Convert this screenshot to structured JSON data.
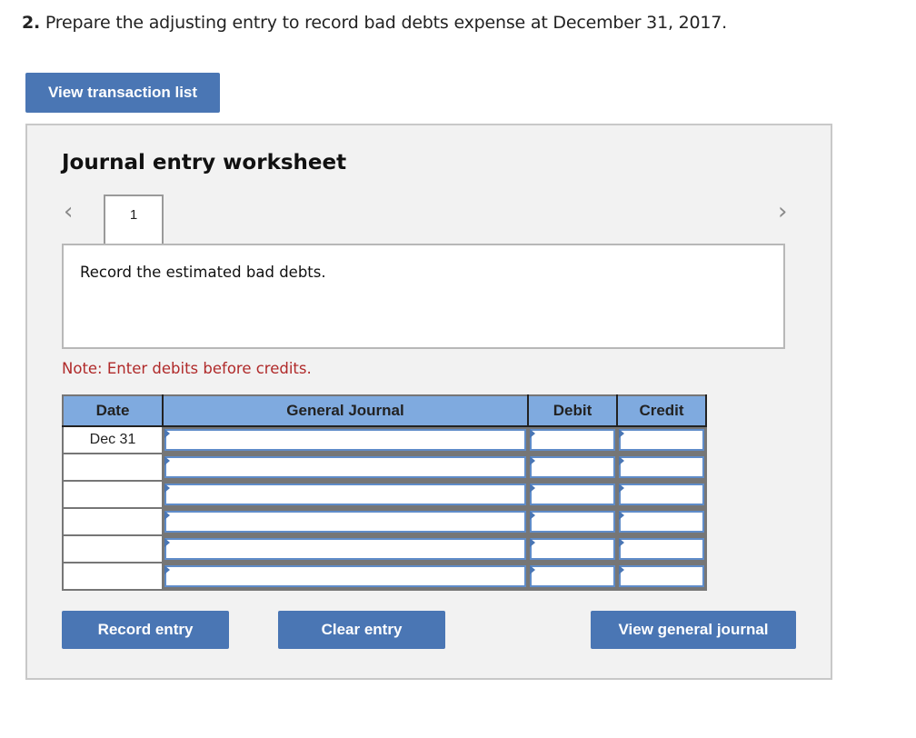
{
  "question": {
    "number": "2.",
    "text": " Prepare the adjusting entry to record bad debts expense at December 31, 2017."
  },
  "buttons": {
    "view_transaction_list": "View transaction list",
    "record_entry": "Record entry",
    "clear_entry": "Clear entry",
    "view_general_journal": "View general journal"
  },
  "worksheet": {
    "title": "Journal entry worksheet",
    "prev_icon": "chevron-left-icon",
    "next_icon": "chevron-right-icon",
    "prev_glyph": "‹",
    "next_glyph": "›",
    "tabs": [
      {
        "label": "1",
        "active": true
      }
    ],
    "description": "Record the estimated bad debts.",
    "note": "Note: Enter debits before credits."
  },
  "table": {
    "headers": {
      "date": "Date",
      "general_journal": "General Journal",
      "debit": "Debit",
      "credit": "Credit"
    },
    "rows": [
      {
        "date": "Dec 31",
        "account": "",
        "debit": "",
        "credit": ""
      },
      {
        "date": "",
        "account": "",
        "debit": "",
        "credit": ""
      },
      {
        "date": "",
        "account": "",
        "debit": "",
        "credit": ""
      },
      {
        "date": "",
        "account": "",
        "debit": "",
        "credit": ""
      },
      {
        "date": "",
        "account": "",
        "debit": "",
        "credit": ""
      },
      {
        "date": "",
        "account": "",
        "debit": "",
        "credit": ""
      }
    ]
  },
  "colors": {
    "button_bg": "#4a76b4",
    "header_bg": "#7faadf",
    "note_text": "#b02a2a",
    "panel_bg": "#f2f2f2"
  }
}
